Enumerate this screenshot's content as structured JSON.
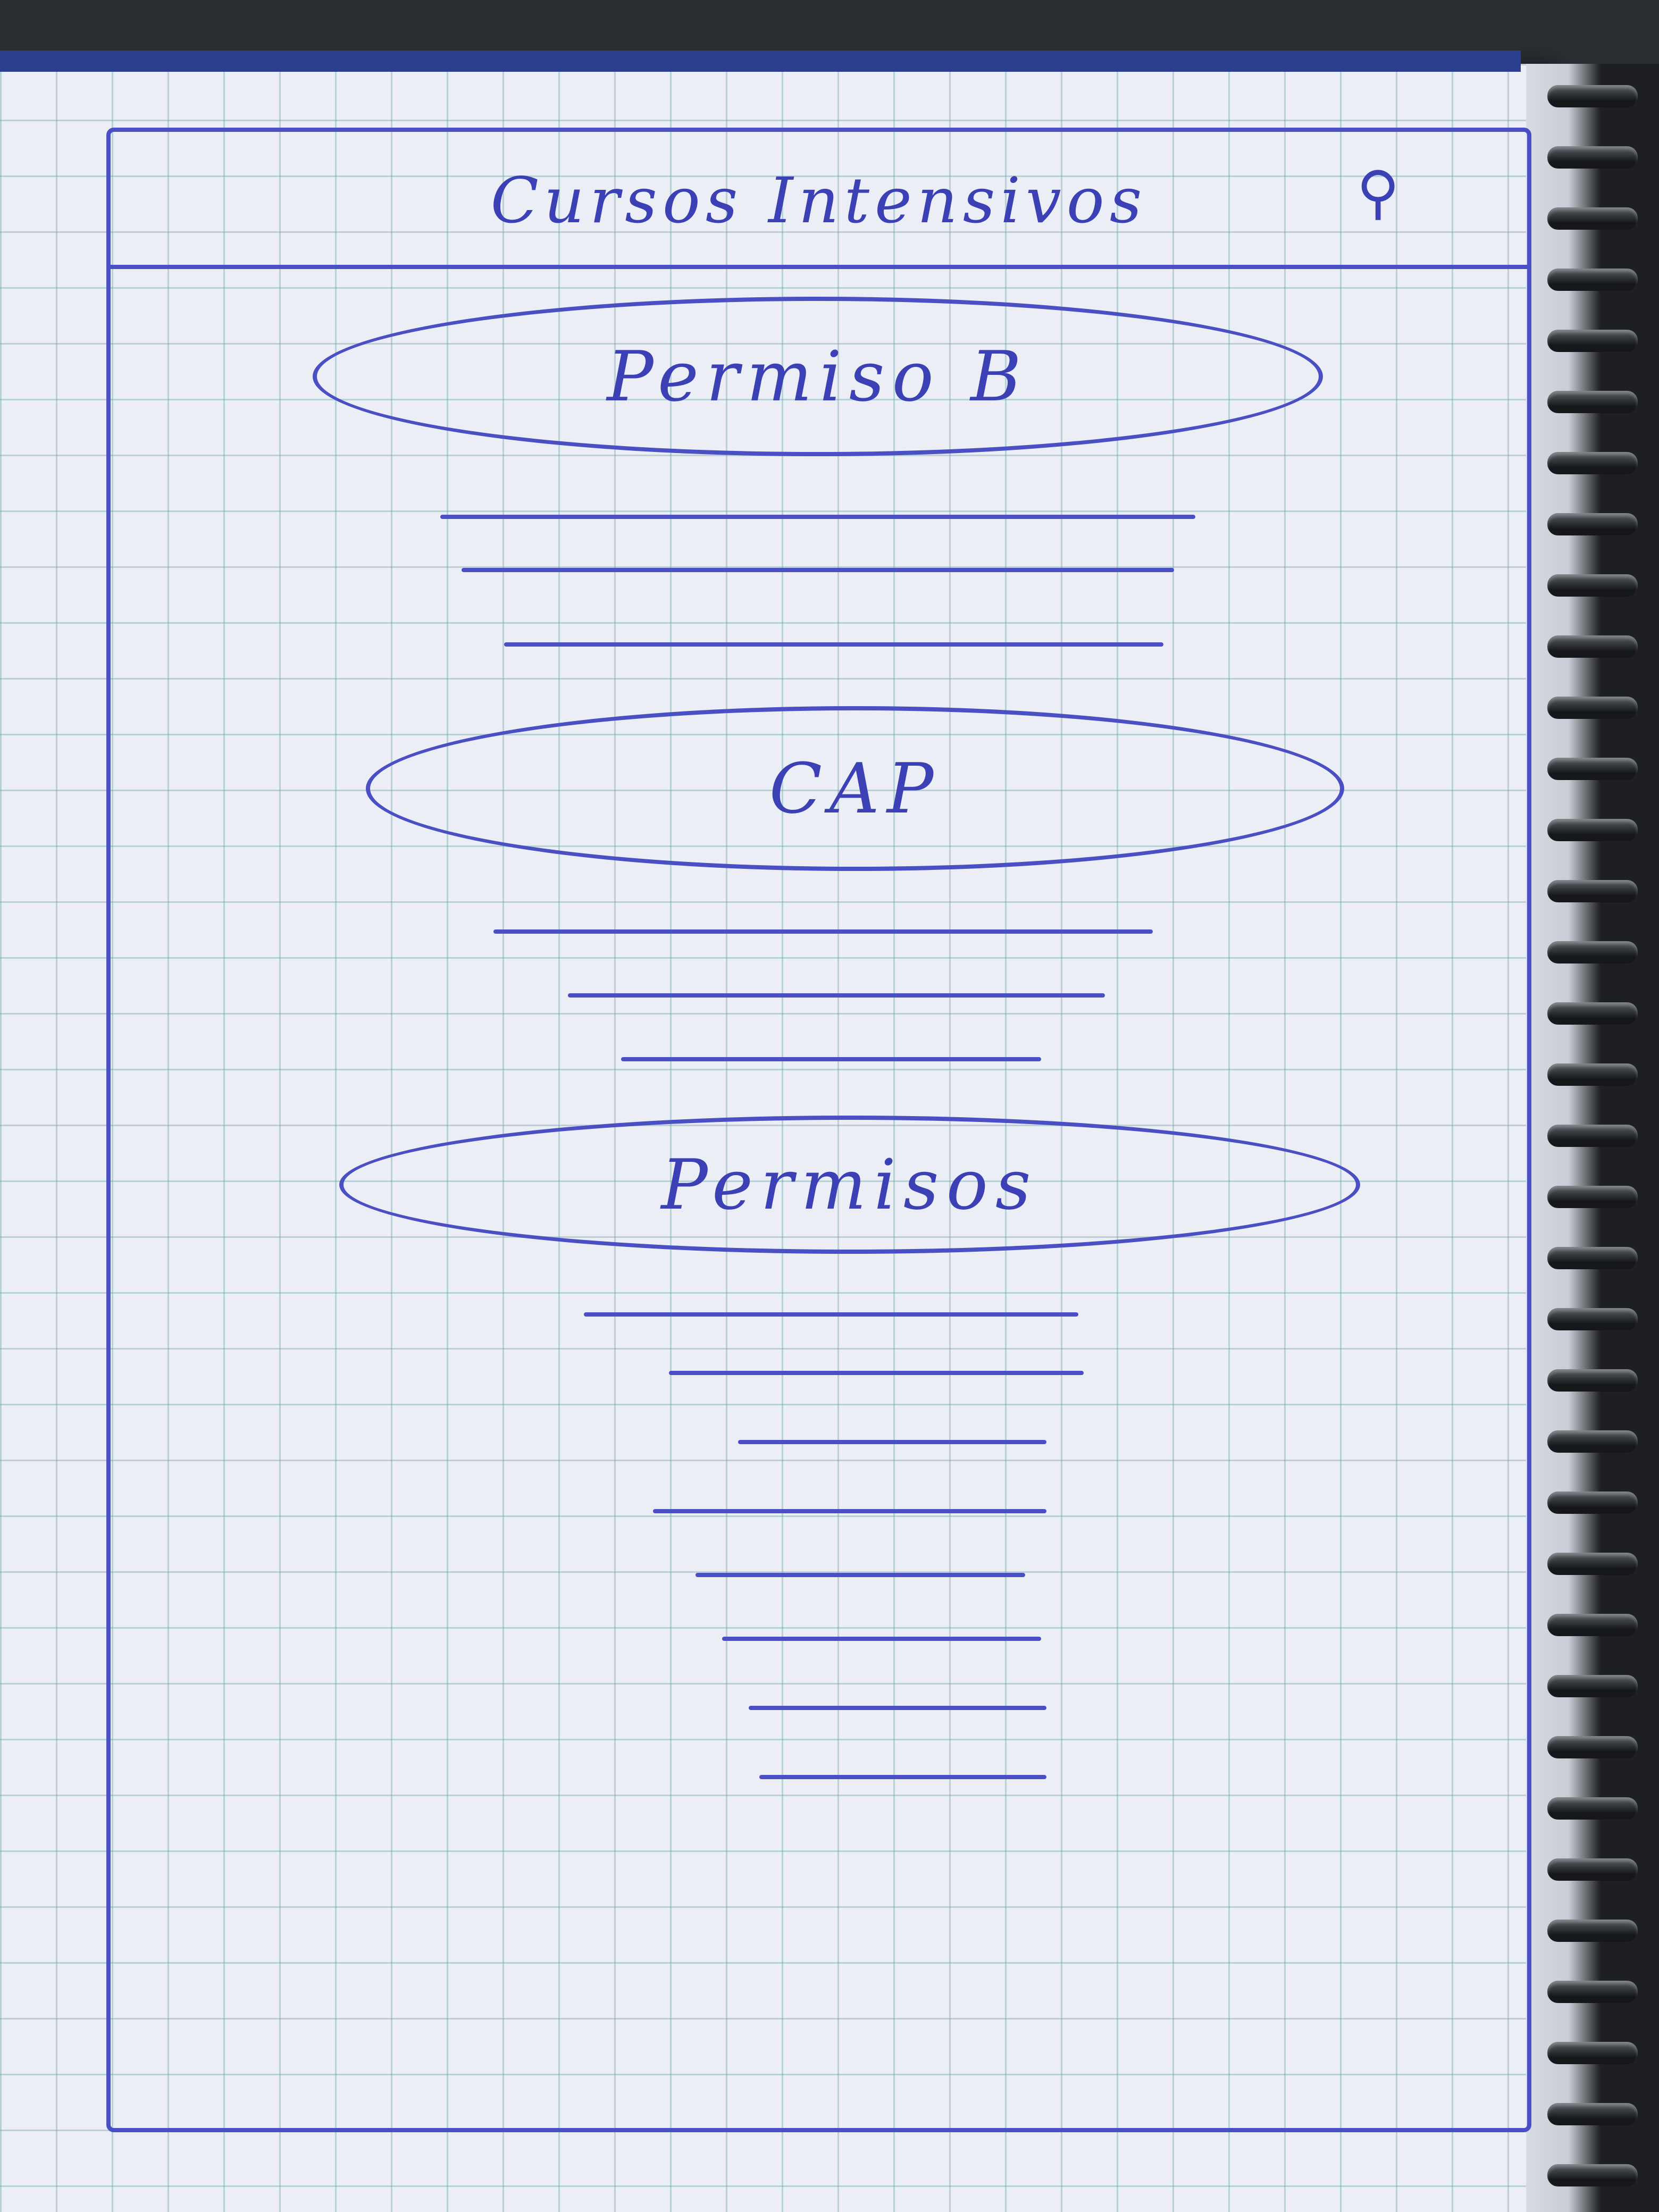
{
  "header": {
    "title": "Cursos Intensivos",
    "icon": "search-icon"
  },
  "sections": [
    {
      "label": "Permiso B",
      "placeholder_lines": 3
    },
    {
      "label": "CAP",
      "placeholder_lines": 3
    },
    {
      "label": "Permisos",
      "placeholder_lines": 8
    }
  ],
  "colors": {
    "ink": "#4a4fc4",
    "paper": "#eceef6",
    "grid": "#78aaaf"
  }
}
